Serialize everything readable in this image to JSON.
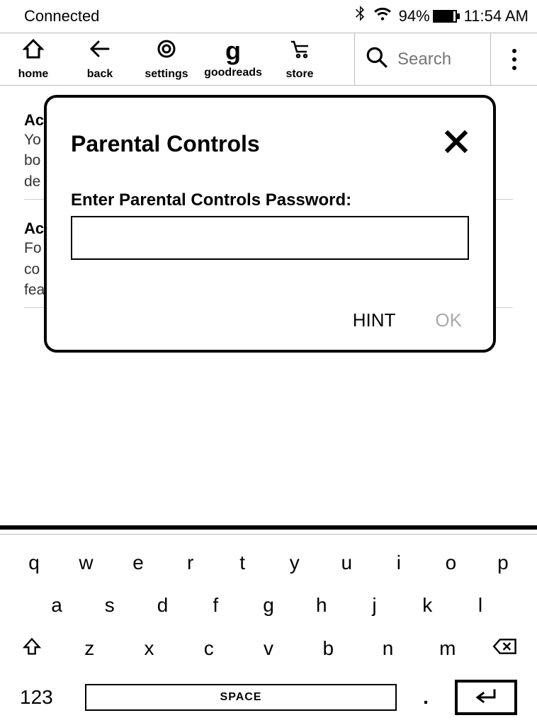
{
  "status": {
    "connection": "Connected",
    "battery_pct": "94%",
    "time": "11:54 AM"
  },
  "toolbar": {
    "home": "home",
    "back": "back",
    "settings": "settings",
    "goodreads": "goodreads",
    "store": "store",
    "search_placeholder": "Search"
  },
  "bg": {
    "row1_title": "Ac",
    "row1_l1": "Yo",
    "row1_l2": "bo",
    "row1_l3": "de",
    "row2_title": "Ac",
    "row2_l1": "Fo",
    "row2_l2": "co",
    "row2_l3": "fea"
  },
  "modal": {
    "title": "Parental Controls",
    "label": "Enter Parental Controls Password:",
    "hint": "HINT",
    "ok": "OK"
  },
  "keyboard": {
    "r1": [
      "q",
      "w",
      "e",
      "r",
      "t",
      "y",
      "u",
      "i",
      "o",
      "p"
    ],
    "r2": [
      "a",
      "s",
      "d",
      "f",
      "g",
      "h",
      "j",
      "k",
      "l"
    ],
    "r3": [
      "z",
      "x",
      "c",
      "v",
      "b",
      "n",
      "m"
    ],
    "numkey": "123",
    "space": "SPACE",
    "period": "."
  }
}
